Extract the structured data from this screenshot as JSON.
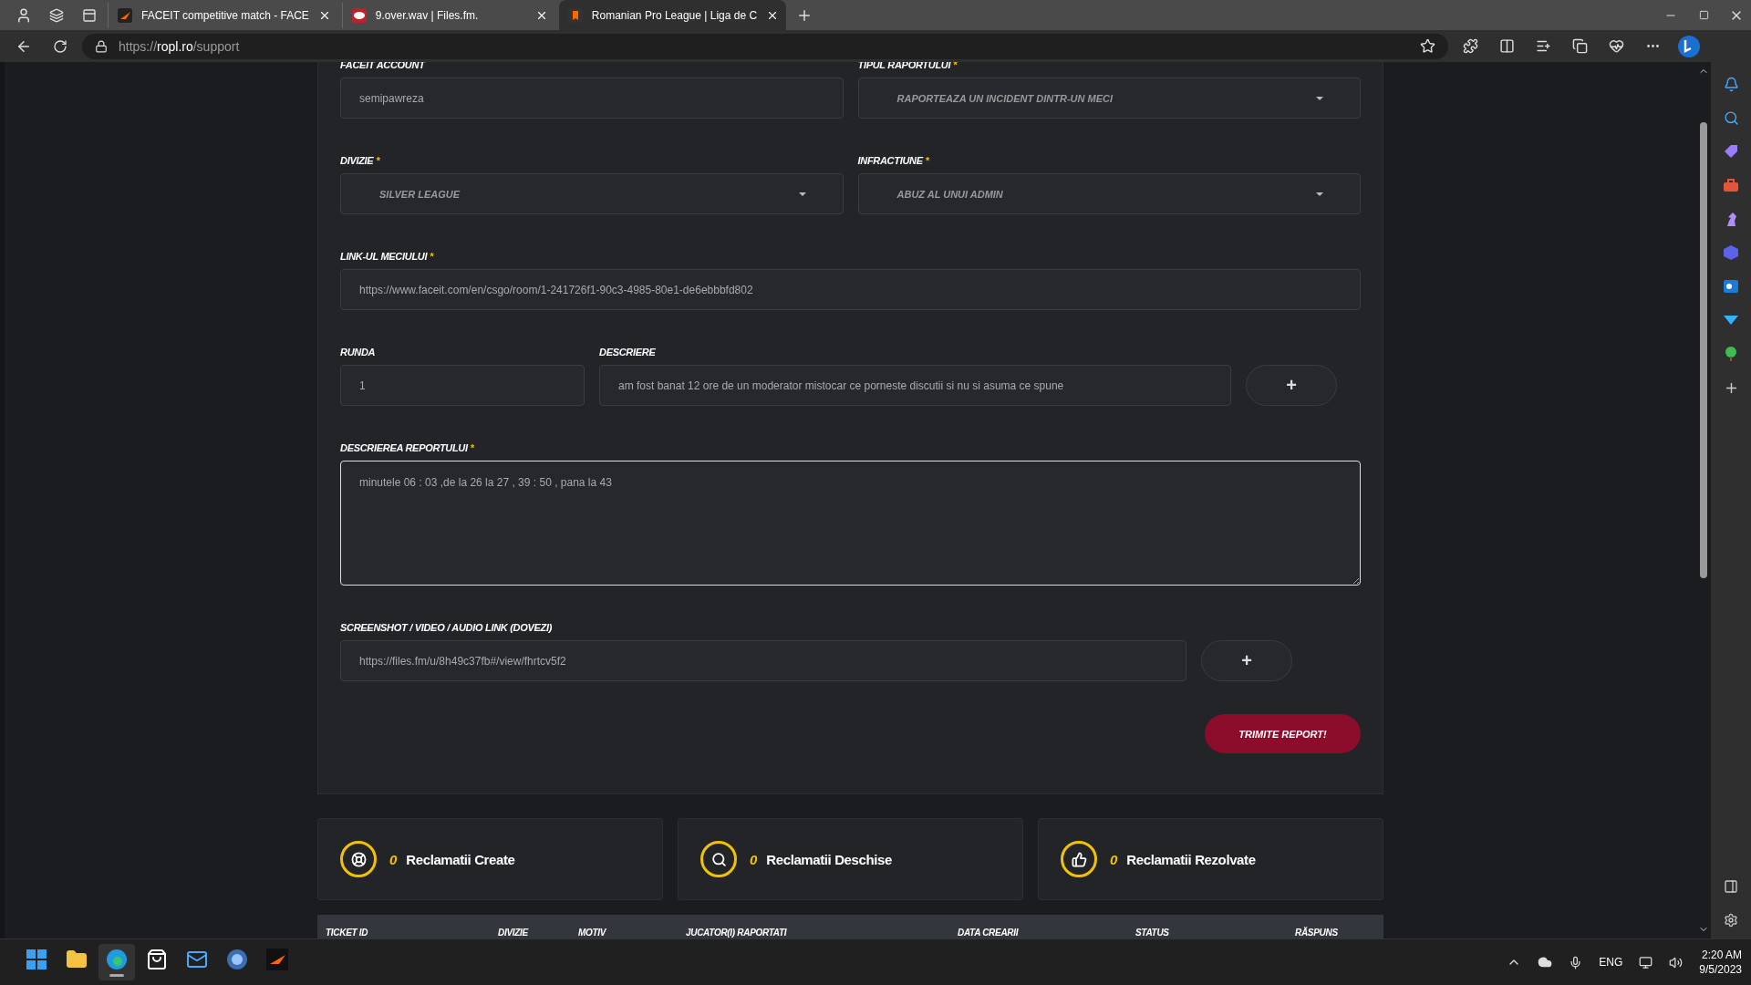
{
  "browser": {
    "tabs": [
      {
        "title": "FACEIT competitive match - FACE",
        "kind": "faceit",
        "selected": false
      },
      {
        "title": "9.over.wav | Files.fm.",
        "kind": "files",
        "selected": false
      },
      {
        "title": "Romanian Pro League | Liga de C",
        "kind": "ropl",
        "selected": true
      }
    ],
    "url": {
      "scheme": "https://",
      "domain": "ropl.ro",
      "path": "/support"
    }
  },
  "form": {
    "rows": [
      [
        {
          "kind": "input",
          "label": "FACEIT ACCOUNT",
          "value": "semipawreza"
        },
        {
          "kind": "select",
          "label": "TIPUL RAPORTULUI",
          "mark": "*",
          "value": "RAPORTEAZA UN INCIDENT DINTR-UN MECI"
        }
      ],
      [
        {
          "kind": "select",
          "label": "DIVIZIE",
          "mark": "*",
          "value": "SILVER LEAGUE"
        },
        {
          "kind": "select",
          "label": "INFRACTIUNE",
          "mark": "*",
          "value": "ABUZ AL UNUI ADMIN"
        }
      ],
      [
        {
          "kind": "input",
          "label": "LINK-UL MECIULUI",
          "mark": "*",
          "value": "https://www.faceit.com/en/csgo/room/1-241726f1-90c3-4985-80e1-de6ebbbfd802"
        }
      ],
      [
        {
          "kind": "input",
          "label": "RUNDA",
          "value": "1"
        },
        {
          "kind": "input",
          "label": "DESCRIERE",
          "value": "am fost banat 12 ore de un moderator mistocar ce porneste discutii si nu si asuma ce spune"
        },
        {
          "kind": "add",
          "label": "+"
        }
      ],
      [
        {
          "kind": "textarea",
          "label": "DESCRIEREA REPORTULUI",
          "mark": "*",
          "value": "minutele 06 : 03 ,de la 26 la 27 , 39 : 50 , pana la 43"
        }
      ],
      [
        {
          "kind": "input",
          "label": "SCREENSHOT / VIDEO / AUDIO LINK (DOVEZI)",
          "value": "https://files.fm/u/8h49c37fb#/view/fhrtcv5f2"
        },
        {
          "kind": "add",
          "label": "+"
        }
      ]
    ],
    "submit": "TRIMITE REPORT!"
  },
  "stats": [
    {
      "count": "0",
      "label": "Reclamatii Create",
      "kind": "created"
    },
    {
      "count": "0",
      "label": "Reclamatii Deschise",
      "kind": "open"
    },
    {
      "count": "0",
      "label": "Reclamatii Rezolvate",
      "kind": "solved"
    }
  ],
  "table": {
    "columns": [
      "TICKET ID",
      "DIVIZIE",
      "MOTIV",
      "JUCATOR(I) RAPORTATI",
      "DATA CREARII",
      "STATUS",
      "RĂSPUNS"
    ]
  },
  "taskbar": {
    "apps": [
      {
        "kind": "start",
        "active": false
      },
      {
        "kind": "explorer",
        "active": false
      },
      {
        "kind": "edge",
        "active": true
      },
      {
        "kind": "store",
        "active": false
      },
      {
        "kind": "mail",
        "active": false
      },
      {
        "kind": "app",
        "active": false
      },
      {
        "kind": "faceit",
        "active": false
      }
    ],
    "language": "ENG",
    "time": "2:20 AM",
    "date": "9/5/2023"
  }
}
